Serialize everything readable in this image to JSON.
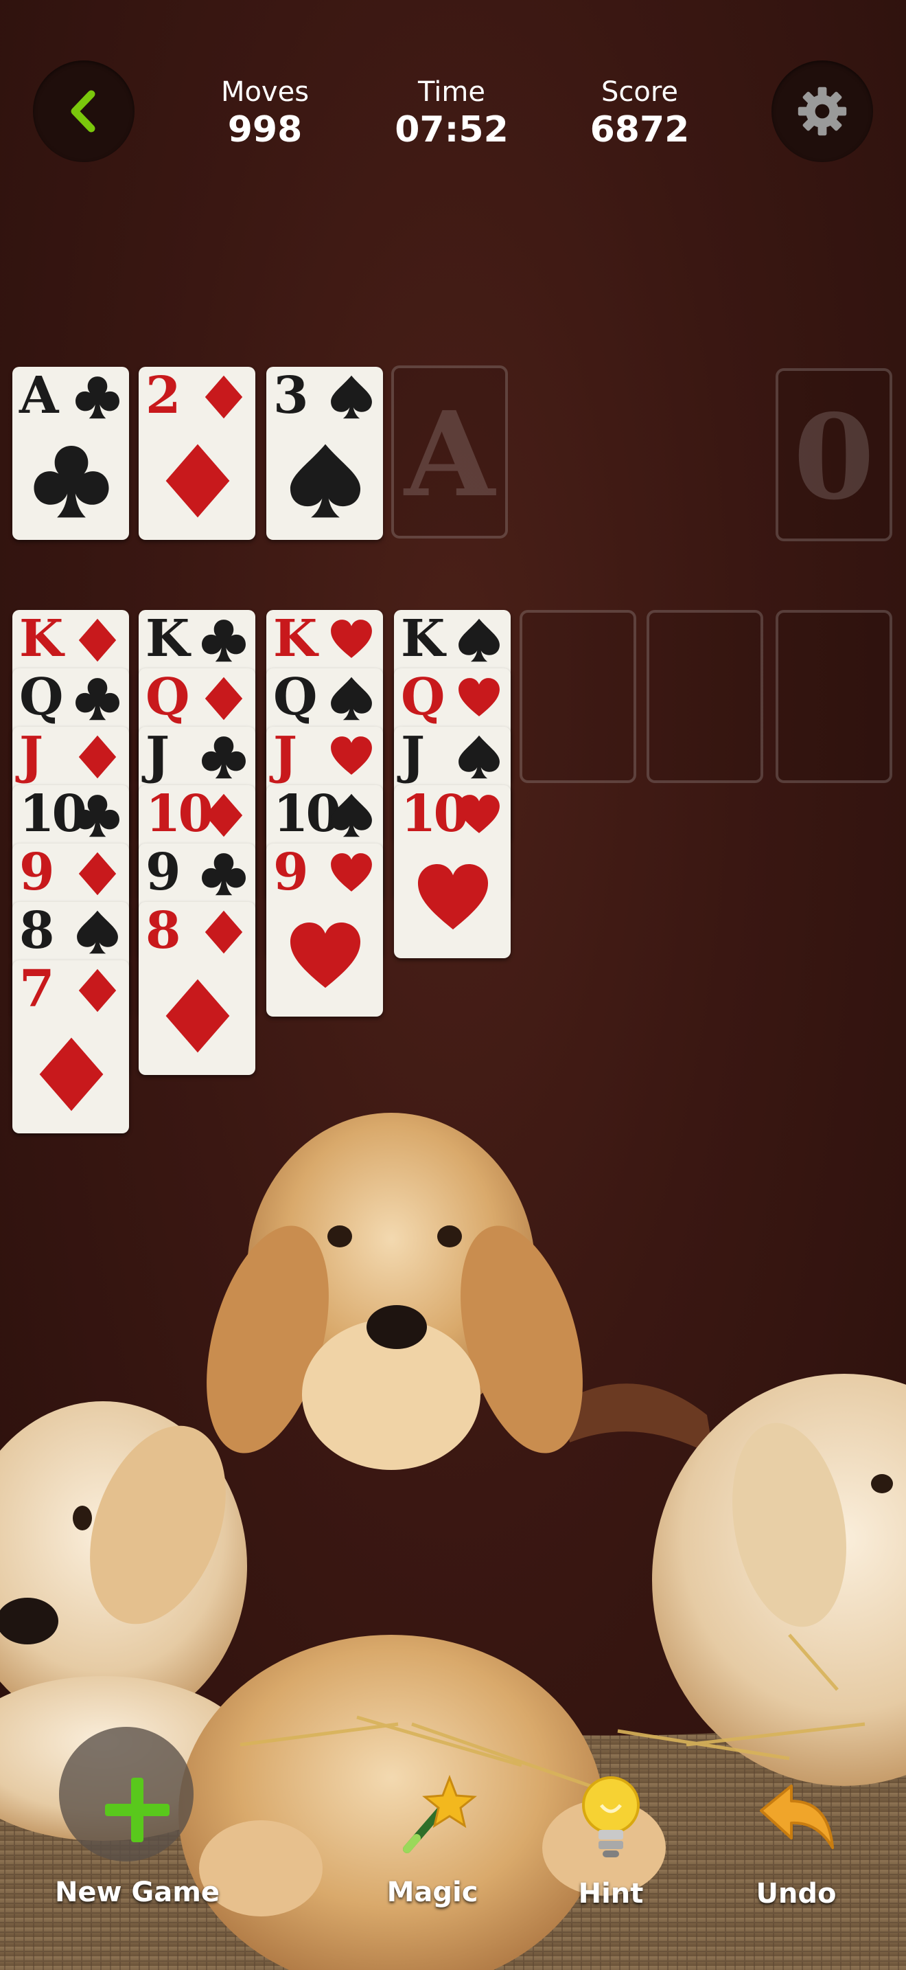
{
  "header": {
    "moves_label": "Moves",
    "moves_value": "998",
    "time_label": "Time",
    "time_value": "07:52",
    "score_label": "Score",
    "score_value": "6872"
  },
  "foundations": [
    {
      "rank": "A",
      "suit": "clubs",
      "color": "black"
    },
    {
      "rank": "2",
      "suit": "diamonds",
      "color": "red"
    },
    {
      "rank": "3",
      "suit": "spades",
      "color": "black"
    }
  ],
  "empty_foundation_label": "A",
  "stock_label": "0",
  "tableau": [
    [
      {
        "rank": "K",
        "suit": "diamonds",
        "color": "red"
      },
      {
        "rank": "Q",
        "suit": "clubs",
        "color": "black"
      },
      {
        "rank": "J",
        "suit": "diamonds",
        "color": "red"
      },
      {
        "rank": "10",
        "suit": "clubs",
        "color": "black"
      },
      {
        "rank": "9",
        "suit": "diamonds",
        "color": "red"
      },
      {
        "rank": "8",
        "suit": "spades",
        "color": "black"
      },
      {
        "rank": "7",
        "suit": "diamonds",
        "color": "red"
      }
    ],
    [
      {
        "rank": "K",
        "suit": "clubs",
        "color": "black"
      },
      {
        "rank": "Q",
        "suit": "diamonds",
        "color": "red"
      },
      {
        "rank": "J",
        "suit": "clubs",
        "color": "black"
      },
      {
        "rank": "10",
        "suit": "diamonds",
        "color": "red"
      },
      {
        "rank": "9",
        "suit": "clubs",
        "color": "black"
      },
      {
        "rank": "8",
        "suit": "diamonds",
        "color": "red"
      }
    ],
    [
      {
        "rank": "K",
        "suit": "hearts",
        "color": "red"
      },
      {
        "rank": "Q",
        "suit": "spades",
        "color": "black"
      },
      {
        "rank": "J",
        "suit": "hearts",
        "color": "red"
      },
      {
        "rank": "10",
        "suit": "spades",
        "color": "black"
      },
      {
        "rank": "9",
        "suit": "hearts",
        "color": "red"
      }
    ],
    [
      {
        "rank": "K",
        "suit": "spades",
        "color": "black"
      },
      {
        "rank": "Q",
        "suit": "hearts",
        "color": "red"
      },
      {
        "rank": "J",
        "suit": "spades",
        "color": "black"
      },
      {
        "rank": "10",
        "suit": "hearts",
        "color": "red"
      }
    ],
    [],
    [],
    []
  ],
  "toolbar": {
    "new_game_label": "New Game",
    "magic_label": "Magic",
    "hint_label": "Hint",
    "undo_label": "Undo"
  },
  "colors": {
    "accent_green": "#7ac70c",
    "card_red": "#c8191c",
    "card_black": "#1b1b1b",
    "card_face": "#f3f1ea",
    "background": "#3a1712"
  },
  "icons": {
    "back": "chevron-left-icon",
    "settings": "gear-icon",
    "new_game": "plus-icon",
    "magic": "magic-wand-icon",
    "hint": "lightbulb-icon",
    "undo": "undo-arrow-icon"
  }
}
